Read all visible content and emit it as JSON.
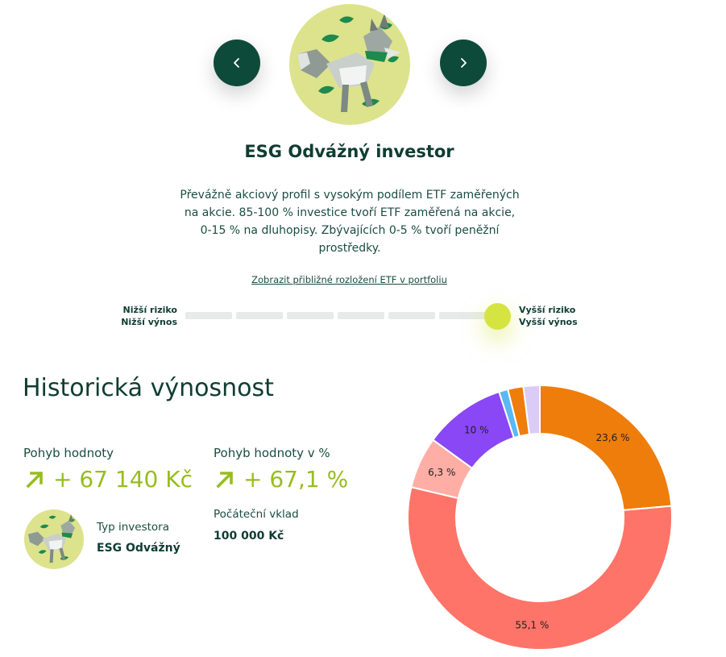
{
  "profile": {
    "title": "ESG Odvážný investor",
    "description": "Převážně akciový profil s vysokým podílem ETF zaměřených na akcie. 85-100 % investice tvoří ETF zaměřená na akcie, 0-15 % na dluhopisy. Zbývajících 0-5 % tvoří peněžní prostředky.",
    "etf_link": "Zobrazit přibližné rozložení ETF v portfoliu",
    "avatar_icon": "fox-with-leaves-illustration"
  },
  "navigation": {
    "prev_icon": "chevron-left-icon",
    "next_icon": "chevron-right-icon"
  },
  "risk": {
    "left_line1": "Nižší riziko",
    "left_line2": "Nižší výnos",
    "right_line1": "Vyšší riziko",
    "right_line2": "Vyšší výnos",
    "level": 7,
    "levels": 7,
    "accent": "#d5e440"
  },
  "history": {
    "title": "Historická výnosnost",
    "value_change_label": "Pohyb hodnoty",
    "value_change": "+ 67 140 Kč",
    "percent_change_label": "Pohyb hodnoty v %",
    "percent_change": "+ 67,1 %",
    "investor_type_label": "Typ investora",
    "investor_type": "ESG Odvážný",
    "initial_deposit_label": "Počáteční vklad",
    "initial_deposit": "100 000 Kč",
    "accent": "#97bd1e"
  },
  "chart_data": {
    "type": "pie",
    "slices": [
      {
        "value": 23.6,
        "label": "23,6 %",
        "color": "#ee7d0c"
      },
      {
        "value": 55.1,
        "label": "55,1 %",
        "color": "#ff7468"
      },
      {
        "value": 6.3,
        "label": "6,3 %",
        "color": "#ffaea6"
      },
      {
        "value": 10,
        "label": "10 %",
        "color": "#8a47f5"
      },
      {
        "value": 1.1,
        "label": "",
        "color": "#5ab8f5"
      },
      {
        "value": 1.9,
        "label": "",
        "color": "#ee7d0c"
      },
      {
        "value": 2.0,
        "label": "",
        "color": "#d9ccf7"
      }
    ]
  }
}
